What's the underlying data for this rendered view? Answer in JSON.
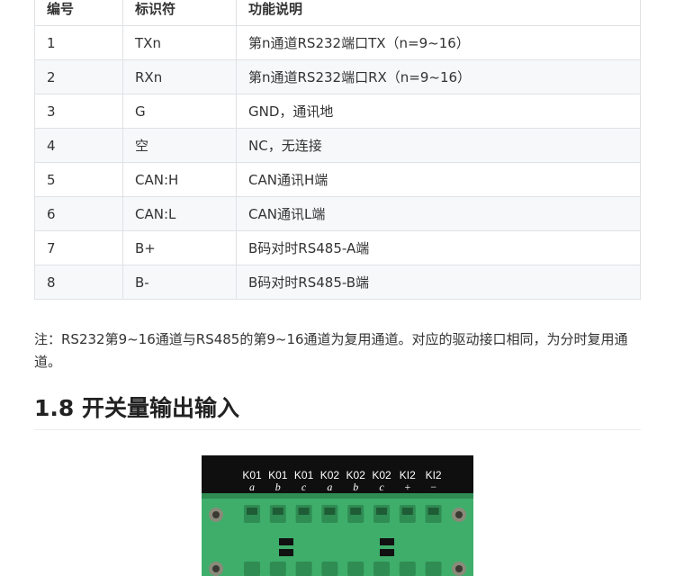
{
  "table": {
    "headers": [
      "编号",
      "标识符",
      "功能说明"
    ],
    "rows": [
      [
        "1",
        "TXn",
        "第n通道RS232端口TX（n=9~16）"
      ],
      [
        "2",
        "RXn",
        "第n通道RS232端口RX（n=9~16）"
      ],
      [
        "3",
        "G",
        "GND，通讯地"
      ],
      [
        "4",
        "空",
        "NC，无连接"
      ],
      [
        "5",
        "CAN:H",
        "CAN通讯H端"
      ],
      [
        "6",
        "CAN:L",
        "CAN通讯L端"
      ],
      [
        "7",
        "B+",
        "B码对时RS485-A端"
      ],
      [
        "8",
        "B-",
        "B码对时RS485-B端"
      ]
    ]
  },
  "note": "注：RS232第9~16通道与RS485的第9~16通道为复用通道。对应的驱动接口相同，为分时复用通道。",
  "section": {
    "title": "1.8 开关量输出输入"
  },
  "figure": {
    "top_labels": [
      "K01",
      "K01",
      "K01",
      "K02",
      "K02",
      "K02",
      "KI2",
      "KI2"
    ],
    "bottom_labels": [
      "a",
      "b",
      "c",
      "a",
      "b",
      "c",
      "+",
      "−"
    ],
    "colors": {
      "board": "#0f0f0f",
      "connector": "#3fae6b",
      "connector_dark": "#2f8c53",
      "label": "#ffffff"
    }
  }
}
